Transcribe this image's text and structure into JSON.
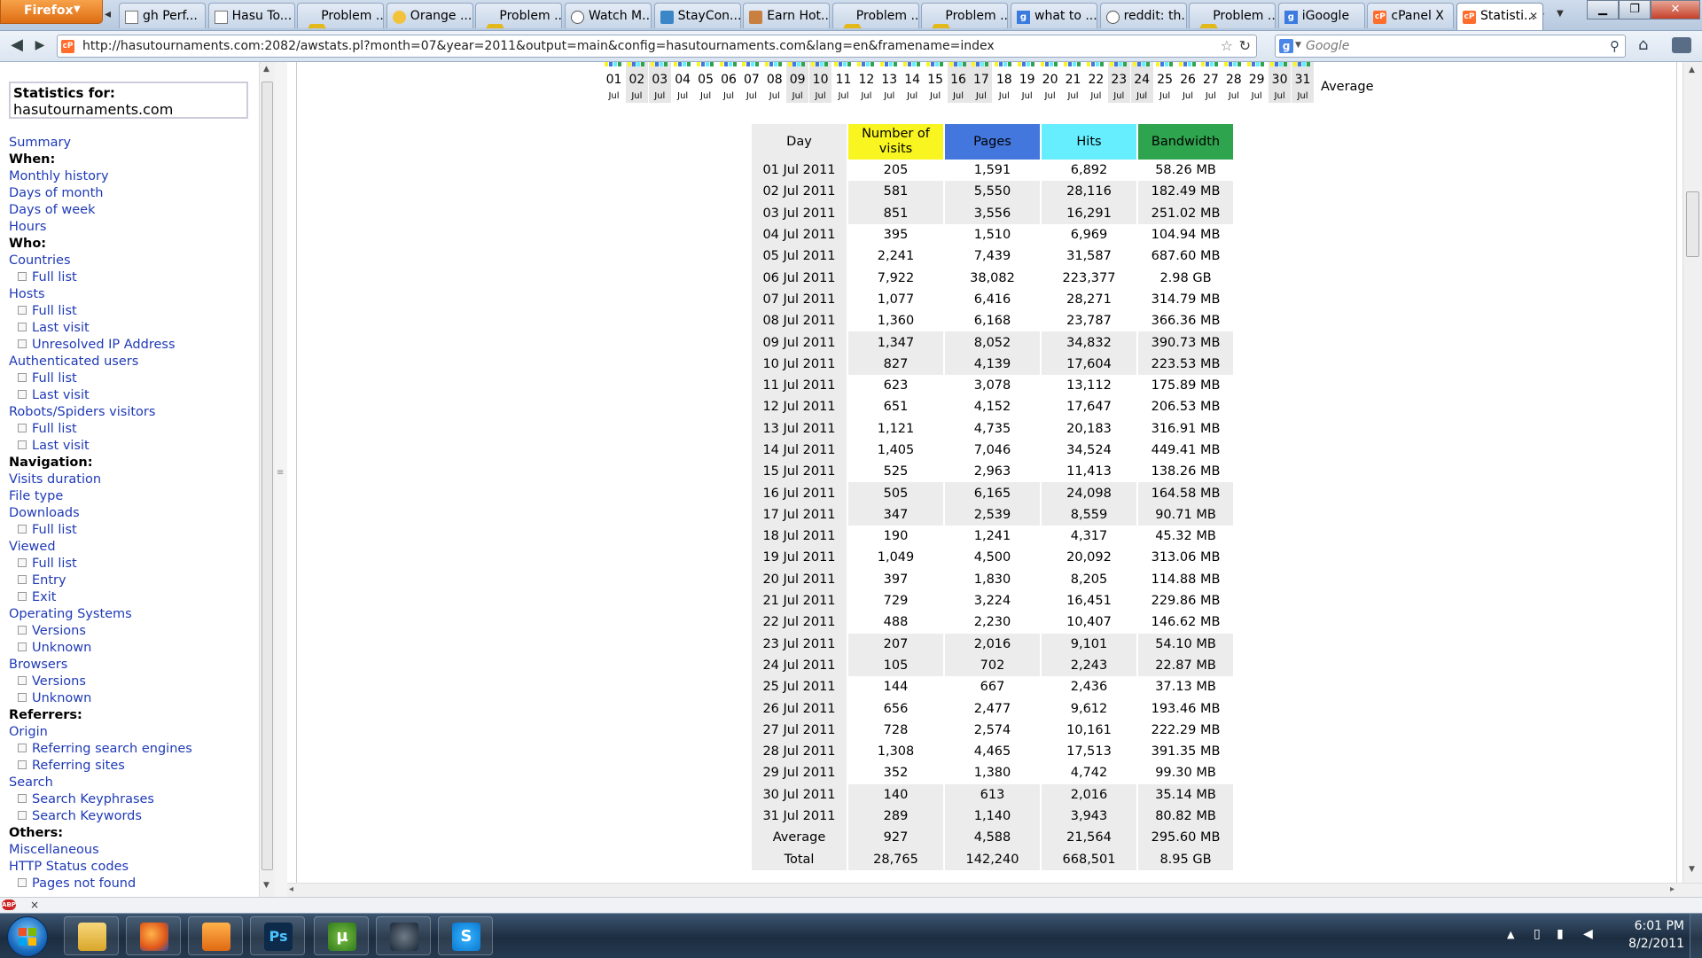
{
  "browser": {
    "app_button": "Firefox",
    "tabs": [
      {
        "label": "gh Perf...",
        "icon": "page-icon"
      },
      {
        "label": "Hasu To...",
        "icon": "page-icon"
      },
      {
        "label": "Problem ...",
        "icon": "warning-icon"
      },
      {
        "label": "Orange ...",
        "icon": "orange-icon"
      },
      {
        "label": "Problem ...",
        "icon": "warning-icon"
      },
      {
        "label": "Watch M...",
        "icon": "watch-icon"
      },
      {
        "label": "StayCon...",
        "icon": "staycon-icon"
      },
      {
        "label": "Earn Hot...",
        "icon": "earn-icon"
      },
      {
        "label": "Problem ...",
        "icon": "warning-icon"
      },
      {
        "label": "Problem ...",
        "icon": "warning-icon"
      },
      {
        "label": "what to ...",
        "icon": "google-icon"
      },
      {
        "label": "reddit: th...",
        "icon": "reddit-icon"
      },
      {
        "label": "Problem ...",
        "icon": "warning-icon"
      },
      {
        "label": "iGoogle",
        "icon": "google-icon"
      },
      {
        "label": "cPanel X",
        "icon": "cpanel-icon"
      },
      {
        "label": "Statisti...",
        "icon": "cpanel-icon",
        "active": true
      }
    ],
    "url": "http://hasutournaments.com:2082/awstats.pl?month=07&year=2011&output=main&config=hasutournaments.com&lang=en&framename=index",
    "search_placeholder": "Google",
    "favicon_text": "cP",
    "search_engine_letter": "g"
  },
  "sidebar": {
    "stats_for_label": "Statistics for:",
    "site": "hasutournaments.com",
    "items": [
      {
        "text": "Summary",
        "kind": "link"
      },
      {
        "text": "When:",
        "kind": "head"
      },
      {
        "text": "Monthly history",
        "kind": "link"
      },
      {
        "text": "Days of month",
        "kind": "link"
      },
      {
        "text": "Days of week",
        "kind": "link"
      },
      {
        "text": "Hours",
        "kind": "link"
      },
      {
        "text": "Who:",
        "kind": "head"
      },
      {
        "text": "Countries",
        "kind": "link"
      },
      {
        "text": "Full list",
        "kind": "sub"
      },
      {
        "text": "Hosts",
        "kind": "link"
      },
      {
        "text": "Full list",
        "kind": "sub"
      },
      {
        "text": "Last visit",
        "kind": "sub"
      },
      {
        "text": "Unresolved IP Address",
        "kind": "sub"
      },
      {
        "text": "Authenticated users",
        "kind": "link"
      },
      {
        "text": "Full list",
        "kind": "sub"
      },
      {
        "text": "Last visit",
        "kind": "sub"
      },
      {
        "text": "Robots/Spiders visitors",
        "kind": "link"
      },
      {
        "text": "Full list",
        "kind": "sub"
      },
      {
        "text": "Last visit",
        "kind": "sub"
      },
      {
        "text": "Navigation:",
        "kind": "head"
      },
      {
        "text": "Visits duration",
        "kind": "link"
      },
      {
        "text": "File type",
        "kind": "link"
      },
      {
        "text": "Downloads",
        "kind": "link"
      },
      {
        "text": "Full list",
        "kind": "sub"
      },
      {
        "text": "Viewed",
        "kind": "link"
      },
      {
        "text": "Full list",
        "kind": "sub"
      },
      {
        "text": "Entry",
        "kind": "sub"
      },
      {
        "text": "Exit",
        "kind": "sub"
      },
      {
        "text": "Operating Systems",
        "kind": "link"
      },
      {
        "text": "Versions",
        "kind": "sub"
      },
      {
        "text": "Unknown",
        "kind": "sub"
      },
      {
        "text": "Browsers",
        "kind": "link"
      },
      {
        "text": "Versions",
        "kind": "sub"
      },
      {
        "text": "Unknown",
        "kind": "sub"
      },
      {
        "text": "Referrers:",
        "kind": "head"
      },
      {
        "text": "Origin",
        "kind": "link"
      },
      {
        "text": "Referring search engines",
        "kind": "sub"
      },
      {
        "text": "Referring sites",
        "kind": "sub"
      },
      {
        "text": "Search",
        "kind": "link"
      },
      {
        "text": "Search Keyphrases",
        "kind": "sub"
      },
      {
        "text": "Search Keywords",
        "kind": "sub"
      },
      {
        "text": "Others:",
        "kind": "head"
      },
      {
        "text": "Miscellaneous",
        "kind": "link"
      },
      {
        "text": "HTTP Status codes",
        "kind": "link"
      },
      {
        "text": "Pages not found",
        "kind": "sub"
      }
    ]
  },
  "day_strip": {
    "month_label": "Jul",
    "days": [
      "01",
      "02",
      "03",
      "04",
      "05",
      "06",
      "07",
      "08",
      "09",
      "10",
      "11",
      "12",
      "13",
      "14",
      "15",
      "16",
      "17",
      "18",
      "19",
      "20",
      "21",
      "22",
      "23",
      "24",
      "25",
      "26",
      "27",
      "28",
      "29",
      "30",
      "31"
    ],
    "weekend_days": [
      "02",
      "03",
      "09",
      "10",
      "16",
      "17",
      "23",
      "24",
      "30",
      "31"
    ],
    "average_label": "Average"
  },
  "table": {
    "headers": {
      "day": "Day",
      "visits": "Number of visits",
      "pages": "Pages",
      "hits": "Hits",
      "bandwidth": "Bandwidth"
    },
    "header_colors": {
      "day": "#ececec",
      "visits": "#f9f520",
      "pages": "#4477dd",
      "hits": "#66eeff",
      "bandwidth": "#2ea44f"
    },
    "rows": [
      {
        "day": "01 Jul 2011",
        "visits": "205",
        "pages": "1,591",
        "hits": "6,892",
        "bandwidth": "58.26 MB"
      },
      {
        "day": "02 Jul 2011",
        "visits": "581",
        "pages": "5,550",
        "hits": "28,116",
        "bandwidth": "182.49 MB"
      },
      {
        "day": "03 Jul 2011",
        "visits": "851",
        "pages": "3,556",
        "hits": "16,291",
        "bandwidth": "251.02 MB"
      },
      {
        "day": "04 Jul 2011",
        "visits": "395",
        "pages": "1,510",
        "hits": "6,969",
        "bandwidth": "104.94 MB"
      },
      {
        "day": "05 Jul 2011",
        "visits": "2,241",
        "pages": "7,439",
        "hits": "31,587",
        "bandwidth": "687.60 MB"
      },
      {
        "day": "06 Jul 2011",
        "visits": "7,922",
        "pages": "38,082",
        "hits": "223,377",
        "bandwidth": "2.98 GB"
      },
      {
        "day": "07 Jul 2011",
        "visits": "1,077",
        "pages": "6,416",
        "hits": "28,271",
        "bandwidth": "314.79 MB"
      },
      {
        "day": "08 Jul 2011",
        "visits": "1,360",
        "pages": "6,168",
        "hits": "23,787",
        "bandwidth": "366.36 MB"
      },
      {
        "day": "09 Jul 2011",
        "visits": "1,347",
        "pages": "8,052",
        "hits": "34,832",
        "bandwidth": "390.73 MB"
      },
      {
        "day": "10 Jul 2011",
        "visits": "827",
        "pages": "4,139",
        "hits": "17,604",
        "bandwidth": "223.53 MB"
      },
      {
        "day": "11 Jul 2011",
        "visits": "623",
        "pages": "3,078",
        "hits": "13,112",
        "bandwidth": "175.89 MB"
      },
      {
        "day": "12 Jul 2011",
        "visits": "651",
        "pages": "4,152",
        "hits": "17,647",
        "bandwidth": "206.53 MB"
      },
      {
        "day": "13 Jul 2011",
        "visits": "1,121",
        "pages": "4,735",
        "hits": "20,183",
        "bandwidth": "316.91 MB"
      },
      {
        "day": "14 Jul 2011",
        "visits": "1,405",
        "pages": "7,046",
        "hits": "34,524",
        "bandwidth": "449.41 MB"
      },
      {
        "day": "15 Jul 2011",
        "visits": "525",
        "pages": "2,963",
        "hits": "11,413",
        "bandwidth": "138.26 MB"
      },
      {
        "day": "16 Jul 2011",
        "visits": "505",
        "pages": "6,165",
        "hits": "24,098",
        "bandwidth": "164.58 MB"
      },
      {
        "day": "17 Jul 2011",
        "visits": "347",
        "pages": "2,539",
        "hits": "8,559",
        "bandwidth": "90.71 MB"
      },
      {
        "day": "18 Jul 2011",
        "visits": "190",
        "pages": "1,241",
        "hits": "4,317",
        "bandwidth": "45.32 MB"
      },
      {
        "day": "19 Jul 2011",
        "visits": "1,049",
        "pages": "4,500",
        "hits": "20,092",
        "bandwidth": "313.06 MB"
      },
      {
        "day": "20 Jul 2011",
        "visits": "397",
        "pages": "1,830",
        "hits": "8,205",
        "bandwidth": "114.88 MB"
      },
      {
        "day": "21 Jul 2011",
        "visits": "729",
        "pages": "3,224",
        "hits": "16,451",
        "bandwidth": "229.86 MB"
      },
      {
        "day": "22 Jul 2011",
        "visits": "488",
        "pages": "2,230",
        "hits": "10,407",
        "bandwidth": "146.62 MB"
      },
      {
        "day": "23 Jul 2011",
        "visits": "207",
        "pages": "2,016",
        "hits": "9,101",
        "bandwidth": "54.10 MB"
      },
      {
        "day": "24 Jul 2011",
        "visits": "105",
        "pages": "702",
        "hits": "2,243",
        "bandwidth": "22.87 MB"
      },
      {
        "day": "25 Jul 2011",
        "visits": "144",
        "pages": "667",
        "hits": "2,436",
        "bandwidth": "37.13 MB"
      },
      {
        "day": "26 Jul 2011",
        "visits": "656",
        "pages": "2,477",
        "hits": "9,612",
        "bandwidth": "193.46 MB"
      },
      {
        "day": "27 Jul 2011",
        "visits": "728",
        "pages": "2,574",
        "hits": "10,161",
        "bandwidth": "222.29 MB"
      },
      {
        "day": "28 Jul 2011",
        "visits": "1,308",
        "pages": "4,465",
        "hits": "17,513",
        "bandwidth": "391.35 MB"
      },
      {
        "day": "29 Jul 2011",
        "visits": "352",
        "pages": "1,380",
        "hits": "4,742",
        "bandwidth": "99.30 MB"
      },
      {
        "day": "30 Jul 2011",
        "visits": "140",
        "pages": "613",
        "hits": "2,016",
        "bandwidth": "35.14 MB"
      },
      {
        "day": "31 Jul 2011",
        "visits": "289",
        "pages": "1,140",
        "hits": "3,943",
        "bandwidth": "80.82 MB"
      }
    ],
    "summary": [
      {
        "day": "Average",
        "visits": "927",
        "pages": "4,588",
        "hits": "21,564",
        "bandwidth": "295.60 MB"
      },
      {
        "day": "Total",
        "visits": "28,765",
        "pages": "142,240",
        "hits": "668,501",
        "bandwidth": "8.95 GB"
      }
    ]
  },
  "addon_bar": {
    "abp_label": "ABP",
    "close": "×"
  },
  "taskbar": {
    "apps": [
      {
        "name": "explorer",
        "label": ""
      },
      {
        "name": "firefox",
        "label": ""
      },
      {
        "name": "media-player",
        "label": ""
      },
      {
        "name": "photoshop",
        "label": "Ps"
      },
      {
        "name": "utorrent",
        "label": "µ"
      },
      {
        "name": "steam",
        "label": ""
      },
      {
        "name": "skype",
        "label": "S"
      }
    ],
    "time": "6:01 PM",
    "date": "8/2/2011"
  }
}
